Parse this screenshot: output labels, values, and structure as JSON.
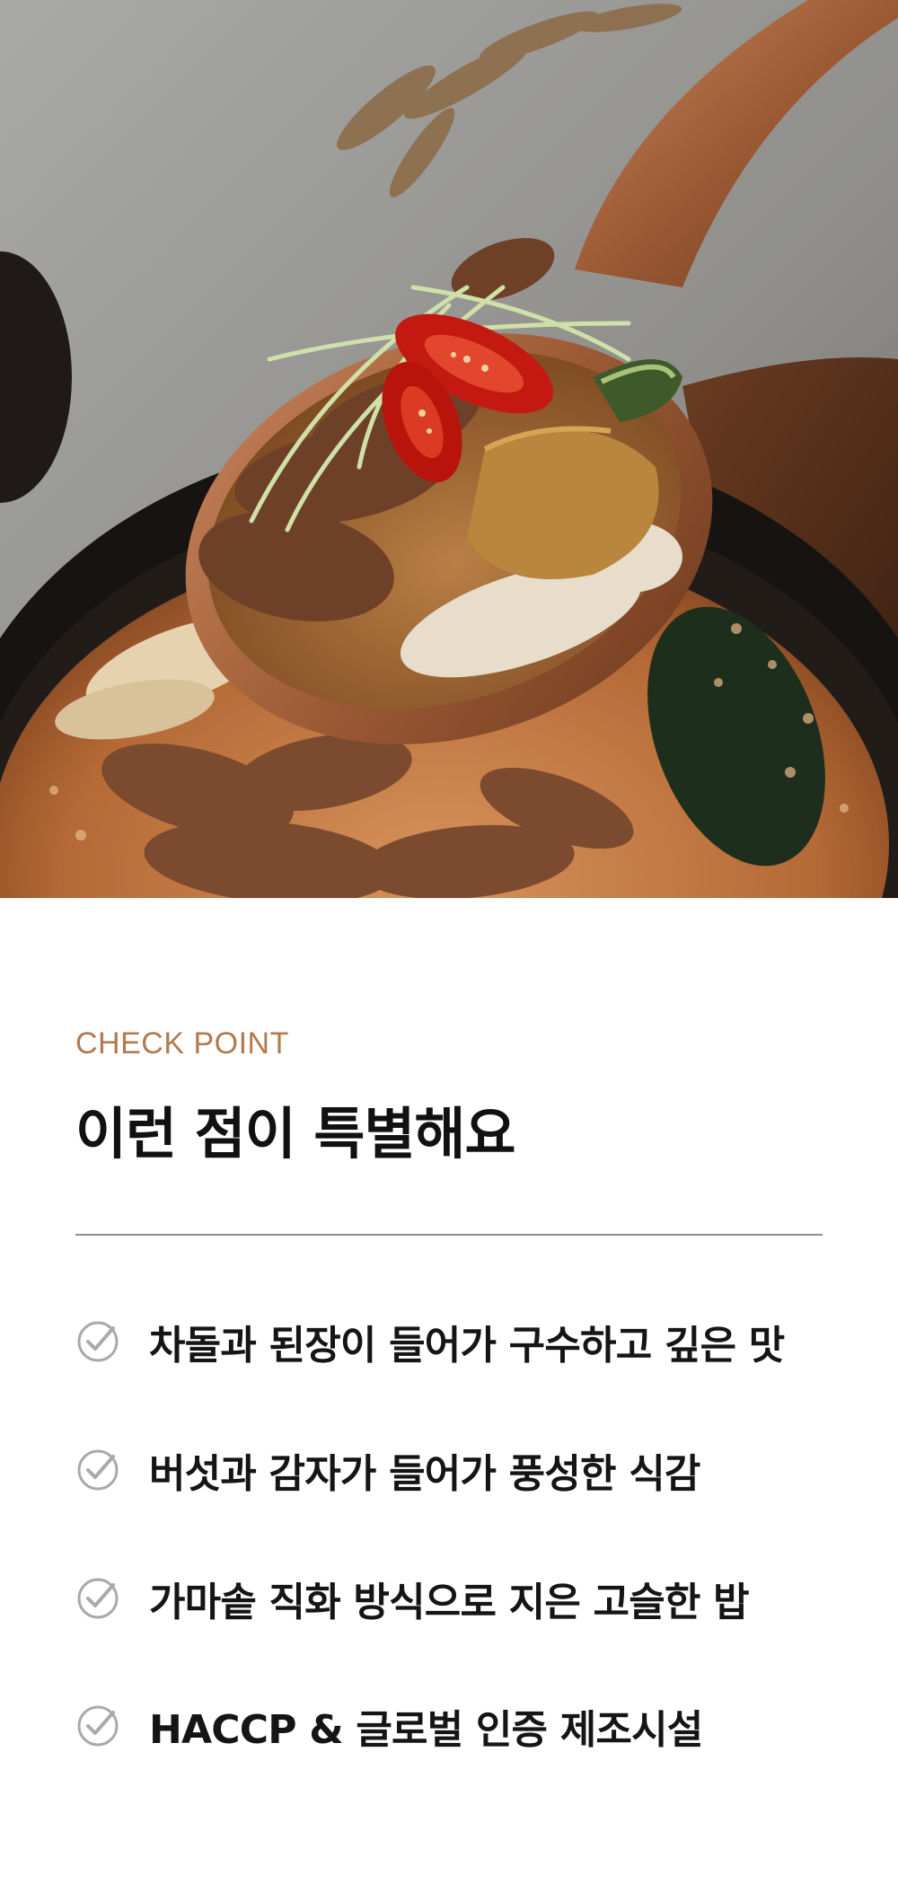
{
  "colors": {
    "accent": "#b27a4e",
    "title": "#111111",
    "divider": "#8e8e8e",
    "check": "#a9a9a9"
  },
  "hero": {
    "image": "beef-doenjang-rice-porridge-on-wooden-spoon"
  },
  "section": {
    "eyebrow": "CHECK POINT",
    "title": "이런 점이 특별해요"
  },
  "points": [
    {
      "icon": "check-circle-icon",
      "text": "차돌과 된장이 들어가 구수하고 깊은 맛"
    },
    {
      "icon": "check-circle-icon",
      "text": "버섯과 감자가 들어가 풍성한 식감"
    },
    {
      "icon": "check-circle-icon",
      "text": "가마솥 직화 방식으로 지은 고슬한 밥"
    },
    {
      "icon": "check-circle-icon",
      "text": "HACCP & 글로벌 인증 제조시설"
    }
  ]
}
